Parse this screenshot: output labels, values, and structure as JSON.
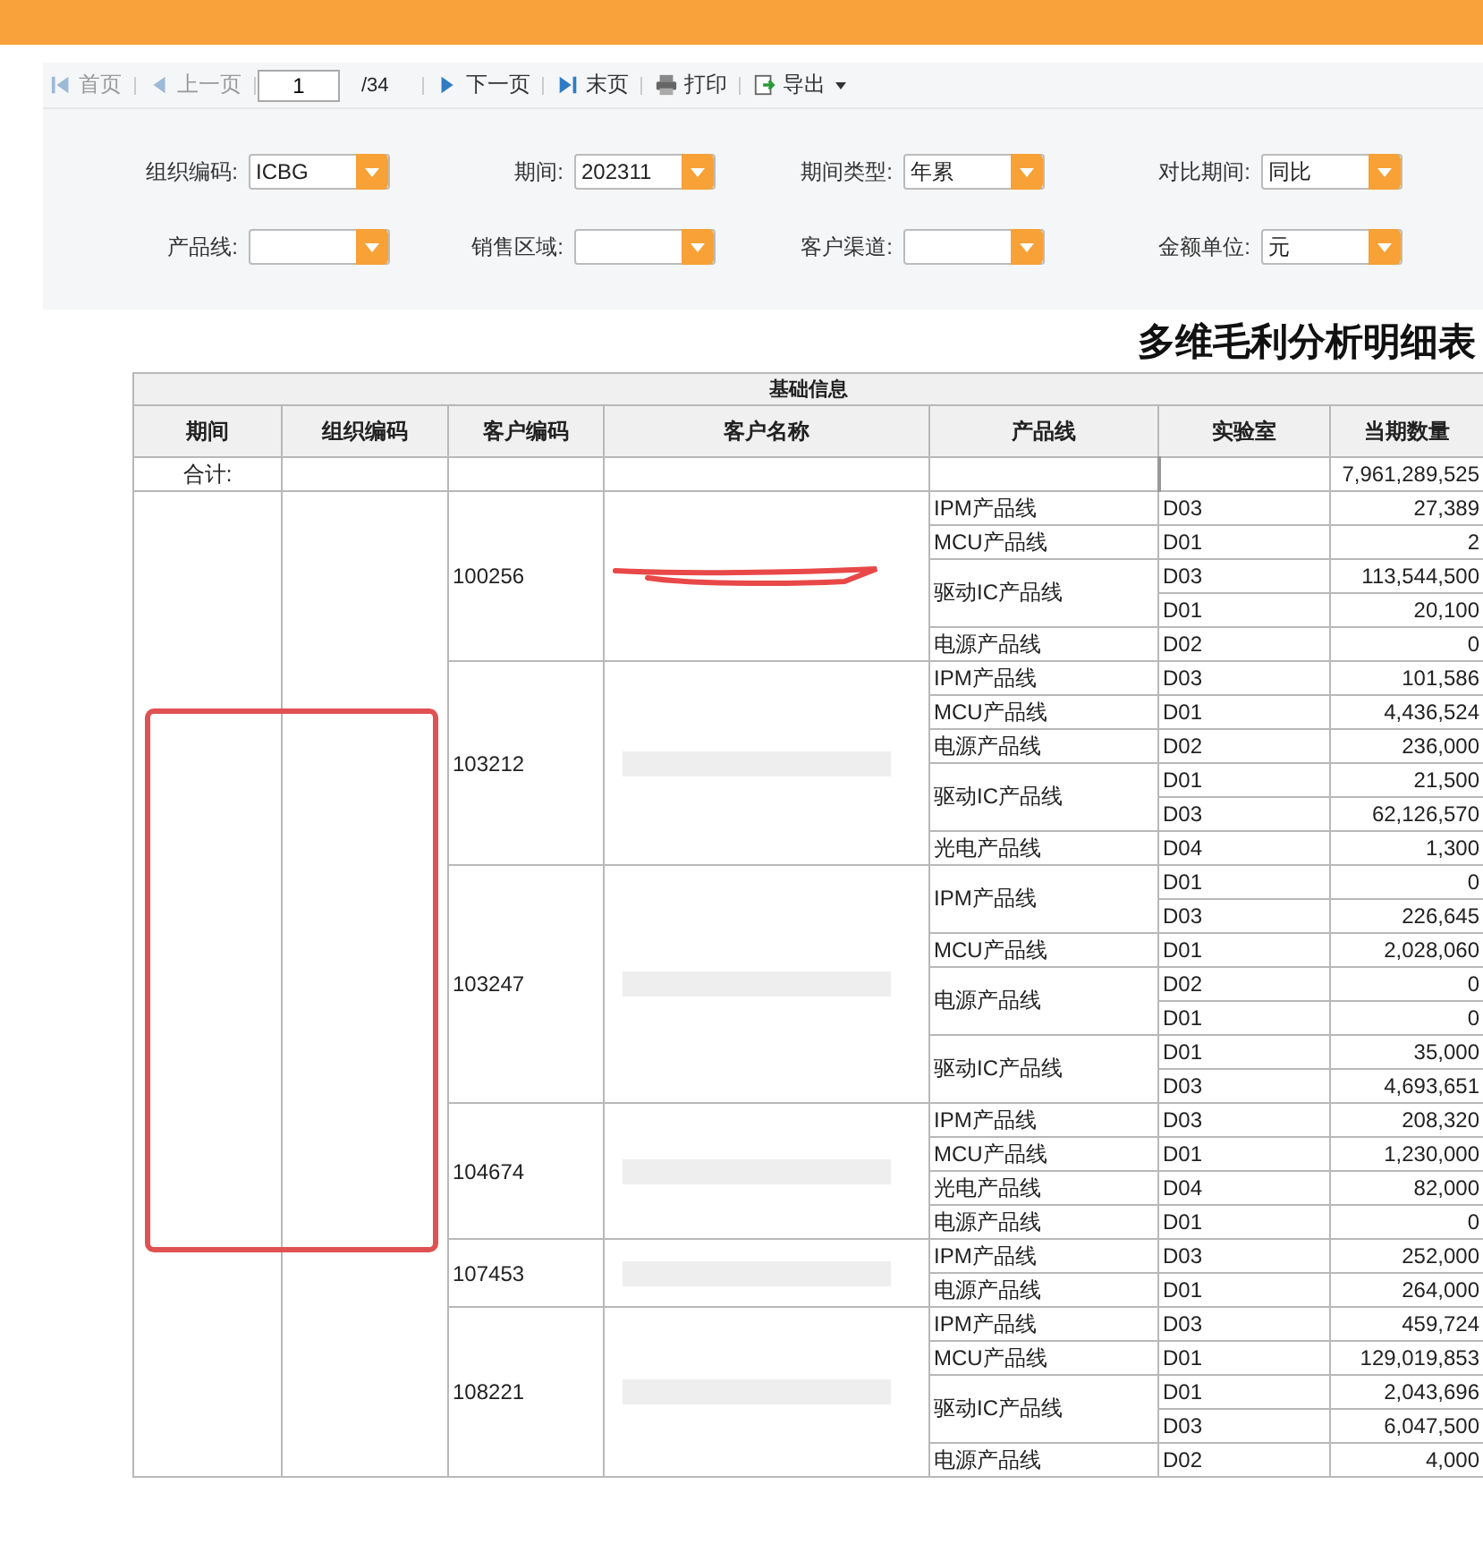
{
  "toolbar": {
    "items": [
      {
        "kind": "first",
        "label": "首页",
        "disabled": true
      },
      {
        "kind": "prev",
        "label": "上一页",
        "disabled": true
      },
      {
        "kind": "page",
        "value": "1",
        "total": "/34"
      },
      {
        "kind": "next",
        "label": "下一页",
        "disabled": false
      },
      {
        "kind": "last",
        "label": "末页",
        "disabled": false
      },
      {
        "kind": "print",
        "label": "打印",
        "disabled": false
      },
      {
        "kind": "export",
        "label": "导出",
        "disabled": false
      }
    ]
  },
  "filters": [
    {
      "label": "组织编码:",
      "value": "ICBG"
    },
    {
      "label": "期间:",
      "value": "202311"
    },
    {
      "label": "期间类型:",
      "value": "年累"
    },
    {
      "label": "对比期间:",
      "value": "同比"
    },
    {
      "label": "产品线:"
    },
    {
      "label": "销售区域:"
    },
    {
      "label": "客户渠道:"
    },
    {
      "label": "金额单位:",
      "value": "元"
    }
  ],
  "report": {
    "title": "多维毛利分析明细表",
    "group_header": "基础信息",
    "columns": [
      "期间",
      "组织编码",
      "客户编码",
      "客户名称",
      "产品线",
      "实验室",
      "当期数量"
    ],
    "total": {
      "label": "合计:",
      "qty": "7,961,289,525"
    },
    "customers": [
      {
        "code": "100256",
        "kind": "scribbled",
        "lines": [
          {
            "name": "IPM产品线",
            "labs": [
              {
                "lab": "D03",
                "qty": "27,389"
              }
            ]
          },
          {
            "name": "MCU产品线",
            "labs": [
              {
                "lab": "D01",
                "qty": "2"
              }
            ]
          },
          {
            "name": "驱动IC产品线",
            "labs": [
              {
                "lab": "D03",
                "qty": "113,544,500"
              },
              {
                "lab": "D01",
                "qty": "20,100"
              }
            ]
          },
          {
            "name": "电源产品线",
            "labs": [
              {
                "lab": "D02",
                "qty": "0"
              }
            ]
          }
        ]
      },
      {
        "code": "103212",
        "kind": "blurred",
        "lines": [
          {
            "name": "IPM产品线",
            "labs": [
              {
                "lab": "D03",
                "qty": "101,586"
              }
            ]
          },
          {
            "name": "MCU产品线",
            "labs": [
              {
                "lab": "D01",
                "qty": "4,436,524"
              }
            ]
          },
          {
            "name": "电源产品线",
            "labs": [
              {
                "lab": "D02",
                "qty": "236,000"
              }
            ]
          },
          {
            "name": "驱动IC产品线",
            "labs": [
              {
                "lab": "D01",
                "qty": "21,500"
              },
              {
                "lab": "D03",
                "qty": "62,126,570"
              }
            ]
          },
          {
            "name": "光电产品线",
            "labs": [
              {
                "lab": "D04",
                "qty": "1,300"
              }
            ]
          }
        ]
      },
      {
        "code": "103247",
        "kind": "blurred",
        "lines": [
          {
            "name": "IPM产品线",
            "labs": [
              {
                "lab": "D01",
                "qty": "0"
              },
              {
                "lab": "D03",
                "qty": "226,645"
              }
            ]
          },
          {
            "name": "MCU产品线",
            "labs": [
              {
                "lab": "D01",
                "qty": "2,028,060"
              }
            ]
          },
          {
            "name": "电源产品线",
            "labs": [
              {
                "lab": "D02",
                "qty": "0"
              },
              {
                "lab": "D01",
                "qty": "0"
              }
            ]
          },
          {
            "name": "驱动IC产品线",
            "labs": [
              {
                "lab": "D01",
                "qty": "35,000"
              },
              {
                "lab": "D03",
                "qty": "4,693,651"
              }
            ]
          }
        ]
      },
      {
        "code": "104674",
        "kind": "blurred",
        "lines": [
          {
            "name": "IPM产品线",
            "labs": [
              {
                "lab": "D03",
                "qty": "208,320"
              }
            ]
          },
          {
            "name": "MCU产品线",
            "labs": [
              {
                "lab": "D01",
                "qty": "1,230,000"
              }
            ]
          },
          {
            "name": "光电产品线",
            "labs": [
              {
                "lab": "D04",
                "qty": "82,000"
              }
            ]
          },
          {
            "name": "电源产品线",
            "labs": [
              {
                "lab": "D01",
                "qty": "0"
              }
            ]
          }
        ]
      },
      {
        "code": "107453",
        "kind": "blurred",
        "lines": [
          {
            "name": "IPM产品线",
            "labs": [
              {
                "lab": "D03",
                "qty": "252,000"
              }
            ]
          },
          {
            "name": "电源产品线",
            "labs": [
              {
                "lab": "D01",
                "qty": "264,000"
              }
            ]
          }
        ]
      },
      {
        "code": "108221",
        "kind": "blurred",
        "lines": [
          {
            "name": "IPM产品线",
            "labs": [
              {
                "lab": "D03",
                "qty": "459,724"
              }
            ]
          },
          {
            "name": "MCU产品线",
            "labs": [
              {
                "lab": "D01",
                "qty": "129,019,853"
              }
            ]
          },
          {
            "name": "驱动IC产品线",
            "labs": [
              {
                "lab": "D01",
                "qty": "2,043,696"
              },
              {
                "lab": "D03",
                "qty": "6,047,500"
              }
            ]
          },
          {
            "name": "电源产品线",
            "labs": [
              {
                "lab": "D02",
                "qty": "4,000"
              }
            ]
          }
        ]
      }
    ]
  }
}
